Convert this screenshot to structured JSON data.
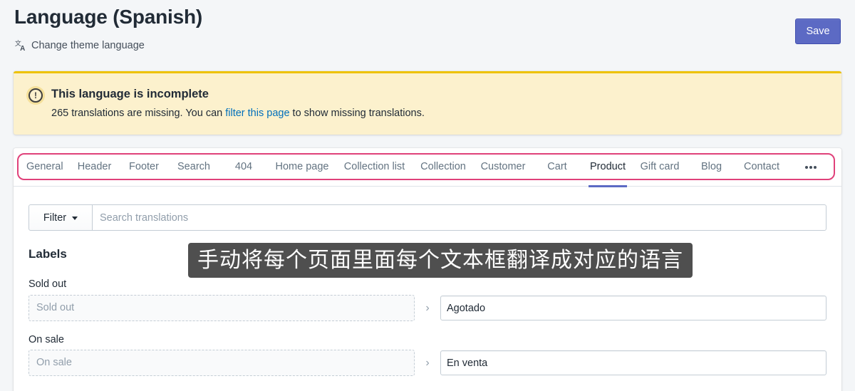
{
  "header": {
    "title": "Language (Spanish)",
    "change_language_label": "Change theme language",
    "save_label": "Save"
  },
  "banner": {
    "title": "This language is incomplete",
    "text_before": "265 translations are missing. You can ",
    "link": "filter this page",
    "text_after": " to show missing translations.",
    "icon_symbol": "!"
  },
  "tabs": [
    {
      "label": "General",
      "active": false
    },
    {
      "label": "Header",
      "active": false
    },
    {
      "label": "Footer",
      "active": false
    },
    {
      "label": "Search",
      "active": false
    },
    {
      "label": "404",
      "active": false
    },
    {
      "label": "Home page",
      "active": false
    },
    {
      "label": "Collection list",
      "active": false
    },
    {
      "label": "Collection",
      "active": false
    },
    {
      "label": "Customer",
      "active": false
    },
    {
      "label": "Cart",
      "active": false
    },
    {
      "label": "Product",
      "active": true
    },
    {
      "label": "Gift card",
      "active": false
    },
    {
      "label": "Blog",
      "active": false
    },
    {
      "label": "Contact",
      "active": false
    }
  ],
  "filter": {
    "button_label": "Filter",
    "search_placeholder": "Search translations"
  },
  "labels_section": {
    "title": "Labels",
    "fields": [
      {
        "label": "Sold out",
        "source": "Sold out",
        "translation": "Agotado"
      },
      {
        "label": "On sale",
        "source": "On sale",
        "translation": "En venta"
      }
    ]
  },
  "caption": "手动将每个页面里面每个文本框翻译成对应的语言",
  "colors": {
    "accent": "#5c6ac4",
    "banner_bg": "#fcf1cd",
    "banner_border": "#eec200",
    "highlight": "#e0417a",
    "link": "#006fbb"
  }
}
